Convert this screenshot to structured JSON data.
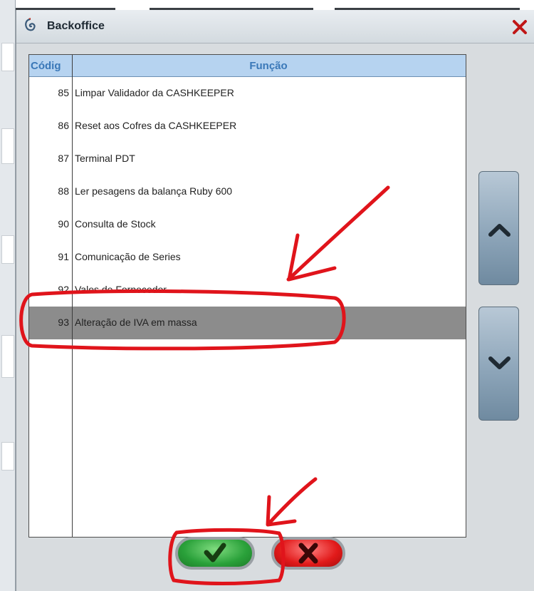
{
  "window": {
    "title": "Backoffice",
    "close_icon": "close-icon"
  },
  "list": {
    "columns": {
      "code": "Códig",
      "function": "Função"
    },
    "rows": [
      {
        "code": "85",
        "label": "Limpar Validador da CASHKEEPER"
      },
      {
        "code": "86",
        "label": "Reset aos Cofres da CASHKEEPER"
      },
      {
        "code": "87",
        "label": "Terminal PDT"
      },
      {
        "code": "88",
        "label": "Ler pesagens da balança Ruby 600"
      },
      {
        "code": "90",
        "label": "Consulta de Stock"
      },
      {
        "code": "91",
        "label": "Comunicação de Series"
      },
      {
        "code": "92",
        "label": "Vales de Fornecedor"
      },
      {
        "code": "93",
        "label": "Alteração de IVA em massa"
      }
    ],
    "selected_code": "93"
  },
  "scroll": {
    "up_icon": "chevron-up-icon",
    "down_icon": "chevron-down-icon"
  },
  "buttons": {
    "ok_icon": "checkmark-icon",
    "cancel_icon": "close-icon"
  },
  "colors": {
    "header_bg": "#b6d3f0",
    "header_text": "#3a78b8",
    "selected_row": "#8c8c8c",
    "annotation": "#e0141b",
    "ok_green": "#2aa13a",
    "cancel_red": "#e11a1a"
  }
}
